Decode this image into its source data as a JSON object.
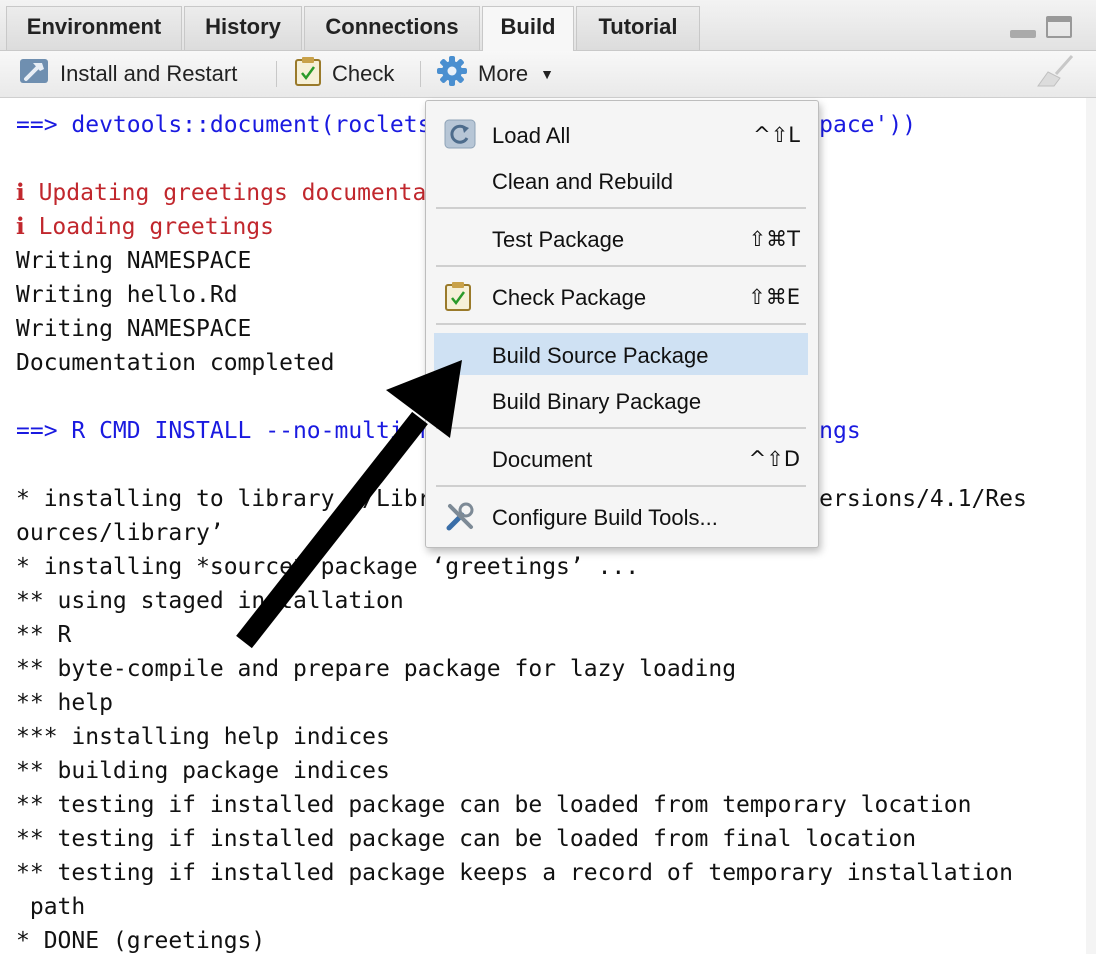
{
  "tabs": [
    {
      "label": "Environment",
      "active": false
    },
    {
      "label": "History",
      "active": false
    },
    {
      "label": "Connections",
      "active": false
    },
    {
      "label": "Build",
      "active": true
    },
    {
      "label": "Tutorial",
      "active": false
    }
  ],
  "toolbar": {
    "install_label": "Install and Restart",
    "check_label": "Check",
    "more_label": "More",
    "install_icon": "hammer-icon",
    "check_icon": "clipboard-check-icon",
    "more_icon": "gear-icon",
    "clear_icon": "broom-icon"
  },
  "console": {
    "lines": [
      {
        "text": "==> devtools::document(roclets = c('rd', 'collate', 'namespace'))",
        "color": "blue"
      },
      {
        "text": "",
        "color": "black"
      },
      {
        "text": "ℹ Updating greetings documentation",
        "color": "red"
      },
      {
        "text": "ℹ Loading greetings",
        "color": "red"
      },
      {
        "text": "Writing NAMESPACE",
        "color": "black"
      },
      {
        "text": "Writing hello.Rd",
        "color": "black"
      },
      {
        "text": "Writing NAMESPACE",
        "color": "black"
      },
      {
        "text": "Documentation completed",
        "color": "black"
      },
      {
        "text": "",
        "color": "black"
      },
      {
        "text": "==> R CMD INSTALL --no-multiarch --with-keep.source greetings",
        "color": "blue"
      },
      {
        "text": "",
        "color": "black"
      },
      {
        "text": "* installing to library ‘/Library/Frameworks/R.framework/Versions/4.1/Res",
        "color": "black"
      },
      {
        "text": "ources/library’",
        "color": "black"
      },
      {
        "text": "* installing *source* package ‘greetings’ ...",
        "color": "black"
      },
      {
        "text": "** using staged installation",
        "color": "black"
      },
      {
        "text": "** R",
        "color": "black"
      },
      {
        "text": "** byte-compile and prepare package for lazy loading",
        "color": "black"
      },
      {
        "text": "** help",
        "color": "black"
      },
      {
        "text": "*** installing help indices",
        "color": "black"
      },
      {
        "text": "** building package indices",
        "color": "black"
      },
      {
        "text": "** testing if installed package can be loaded from temporary location",
        "color": "black"
      },
      {
        "text": "** testing if installed package can be loaded from final location",
        "color": "black"
      },
      {
        "text": "** testing if installed package keeps a record of temporary installation",
        "color": "black"
      },
      {
        "text": " path",
        "color": "black"
      },
      {
        "text": "* DONE (greetings)",
        "color": "black"
      }
    ]
  },
  "menu": {
    "items": [
      {
        "label": "Load All",
        "shortcut": "^⇧L",
        "icon": "reload-icon"
      },
      {
        "label": "Clean and Rebuild",
        "shortcut": "",
        "icon": ""
      },
      {
        "label": "Test Package",
        "shortcut": "⇧⌘T",
        "icon": ""
      },
      {
        "label": "Check Package",
        "shortcut": "⇧⌘E",
        "icon": "clipboard-check-icon"
      },
      {
        "label": "Build Source Package",
        "shortcut": "",
        "icon": "",
        "highlighted": true
      },
      {
        "label": "Build Binary Package",
        "shortcut": "",
        "icon": ""
      },
      {
        "label": "Document",
        "shortcut": "^⇧D",
        "icon": ""
      },
      {
        "label": "Configure Build Tools...",
        "shortcut": "",
        "icon": "tools-icon"
      }
    ]
  },
  "colors": {
    "highlight": "#cfe1f3",
    "console_blue": "#1a1ae0",
    "console_red": "#c1272d"
  }
}
